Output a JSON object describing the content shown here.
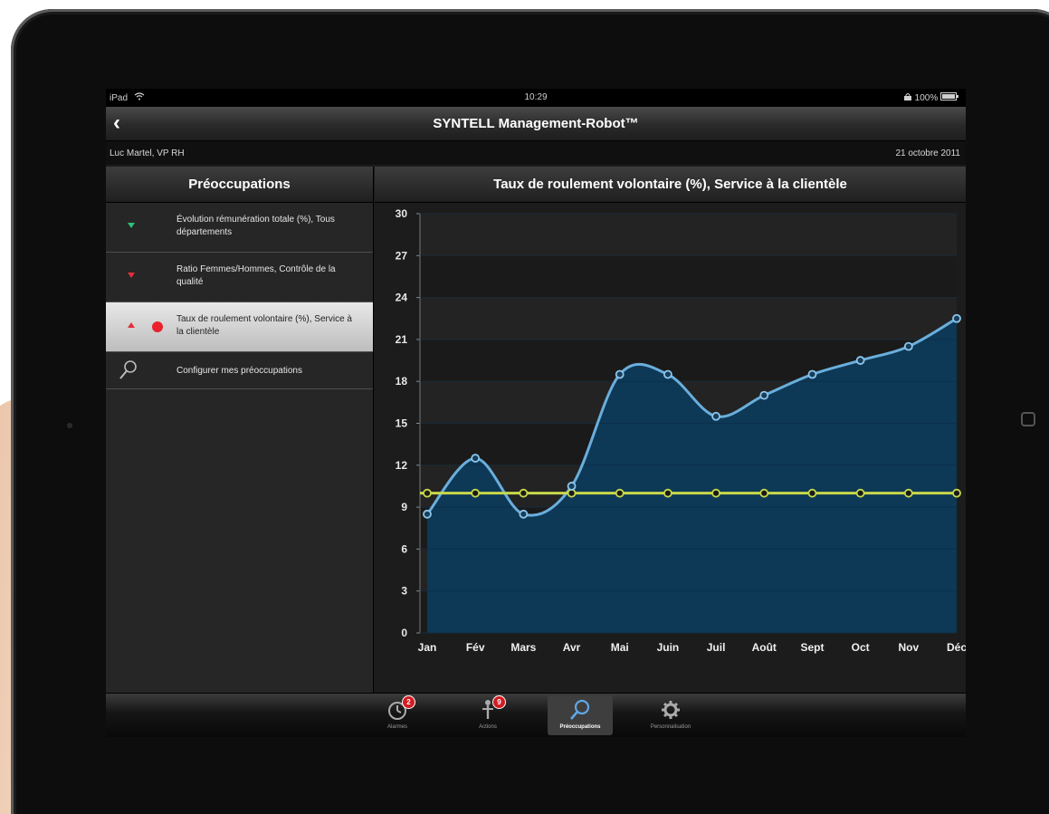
{
  "status_bar": {
    "device": "iPad",
    "time": "10:29",
    "battery": "100%"
  },
  "nav": {
    "title": "SYNTELL Management-Robot™",
    "back_label": "‹"
  },
  "info": {
    "user": "Luc Martel, VP RH",
    "date": "21 octobre 2011"
  },
  "sidebar": {
    "title": "Préoccupations",
    "items": [
      {
        "label": "Évolution rémunération totale (%), Tous départements",
        "indicator": "down-green"
      },
      {
        "label": "Ratio Femmes/Hommes, Contrôle de la qualité",
        "indicator": "down-red"
      },
      {
        "label": "Taux de roulement volontaire (%), Service à la clientèle",
        "indicator": "up-red"
      }
    ],
    "config_label": "Configurer mes préoccupations"
  },
  "chart_data": {
    "type": "area",
    "title": "Taux de roulement volontaire (%), Service à la clientèle",
    "categories": [
      "Jan",
      "Fév",
      "Mars",
      "Avr",
      "Mai",
      "Juin",
      "Juil",
      "Août",
      "Sept",
      "Oct",
      "Nov",
      "Déc"
    ],
    "series": [
      {
        "values": [
          8.5,
          12.5,
          8.5,
          10.5,
          18.5,
          18.5,
          15.5,
          17,
          18.5,
          19.5,
          20.5,
          22.5
        ],
        "color": "#6aaedc",
        "fill": "#0d3a5a"
      },
      {
        "values": [
          10,
          10,
          10,
          10,
          10,
          10,
          10,
          10,
          10,
          10,
          10,
          10
        ],
        "color": "#c8d84a"
      }
    ],
    "ylim": [
      0,
      30
    ],
    "yticks": [
      0,
      3,
      6,
      9,
      12,
      15,
      18,
      21,
      24,
      27,
      30
    ],
    "grid": true
  },
  "tabs": [
    {
      "label": "Alarmes",
      "badge": "2"
    },
    {
      "label": "Actions",
      "badge": "9"
    },
    {
      "label": "Préoccupations",
      "badge": ""
    },
    {
      "label": "Personnalisation",
      "badge": ""
    }
  ],
  "colors": {
    "accent_red": "#e9222e",
    "trend_green": "#2bc27a",
    "line_blue": "#6aaedc",
    "target_yellow": "#c8d84a",
    "area_fill": "#0d3a5a"
  }
}
